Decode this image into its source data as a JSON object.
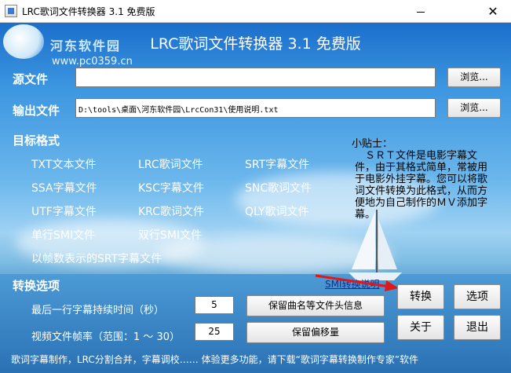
{
  "window": {
    "title": "LRC歌词文件转换器 3.1 免费版",
    "minimize_icon": "minimize-icon",
    "close_icon": "✕"
  },
  "watermark": {
    "site": "河东软件园",
    "url": "www.pc0359.cn"
  },
  "header": "LRC歌词文件转换器  3.1  免费版",
  "source": {
    "label": "源文件",
    "value": "",
    "browse": "浏览..."
  },
  "output": {
    "label": "输出文件",
    "value": "D:\\tools\\桌面\\河东软件园\\LrcCon31\\使用说明.txt",
    "browse": "浏览..."
  },
  "formats": {
    "title": "目标格式",
    "items": [
      "TXT文本文件",
      "LRC歌词文件",
      "SRT字幕文件",
      "SSA字幕文件",
      "KSC字幕文件",
      "SNC歌词文件",
      "UTF字幕文件",
      "KRC歌词文件",
      "QLY歌词文件",
      "单行SMI文件",
      "双行SMI文件",
      "以帧数表示的SRT字幕文件"
    ]
  },
  "tip": {
    "title": "小贴士：",
    "body": "　ＳＲＴ文件是电影字幕文件，由于其格式简单，常被用于电影外挂字幕。您可以将歌词文件转换为此格式，从而方便地为自己制作的ＭＶ添加字幕。"
  },
  "smi_link": "SMI转换说明",
  "options": {
    "title": "转换选项",
    "last_line_label": "最后一行字幕持续时间（秒）",
    "last_line_value": "5",
    "framerate_label": "视频文件帧率（范围：1 ～ 30）",
    "framerate_value": "25",
    "keep_header_button": "保留曲名等文件头信息",
    "keep_offset_button": "保留偏移量"
  },
  "actions": {
    "convert": "转换",
    "options": "选项",
    "about": "关于",
    "exit": "退出"
  },
  "footer": "歌词字幕制作，LRC分割合并，字幕调校……  体验更多功能，请下载“歌词字幕转换制作专家”软件"
}
